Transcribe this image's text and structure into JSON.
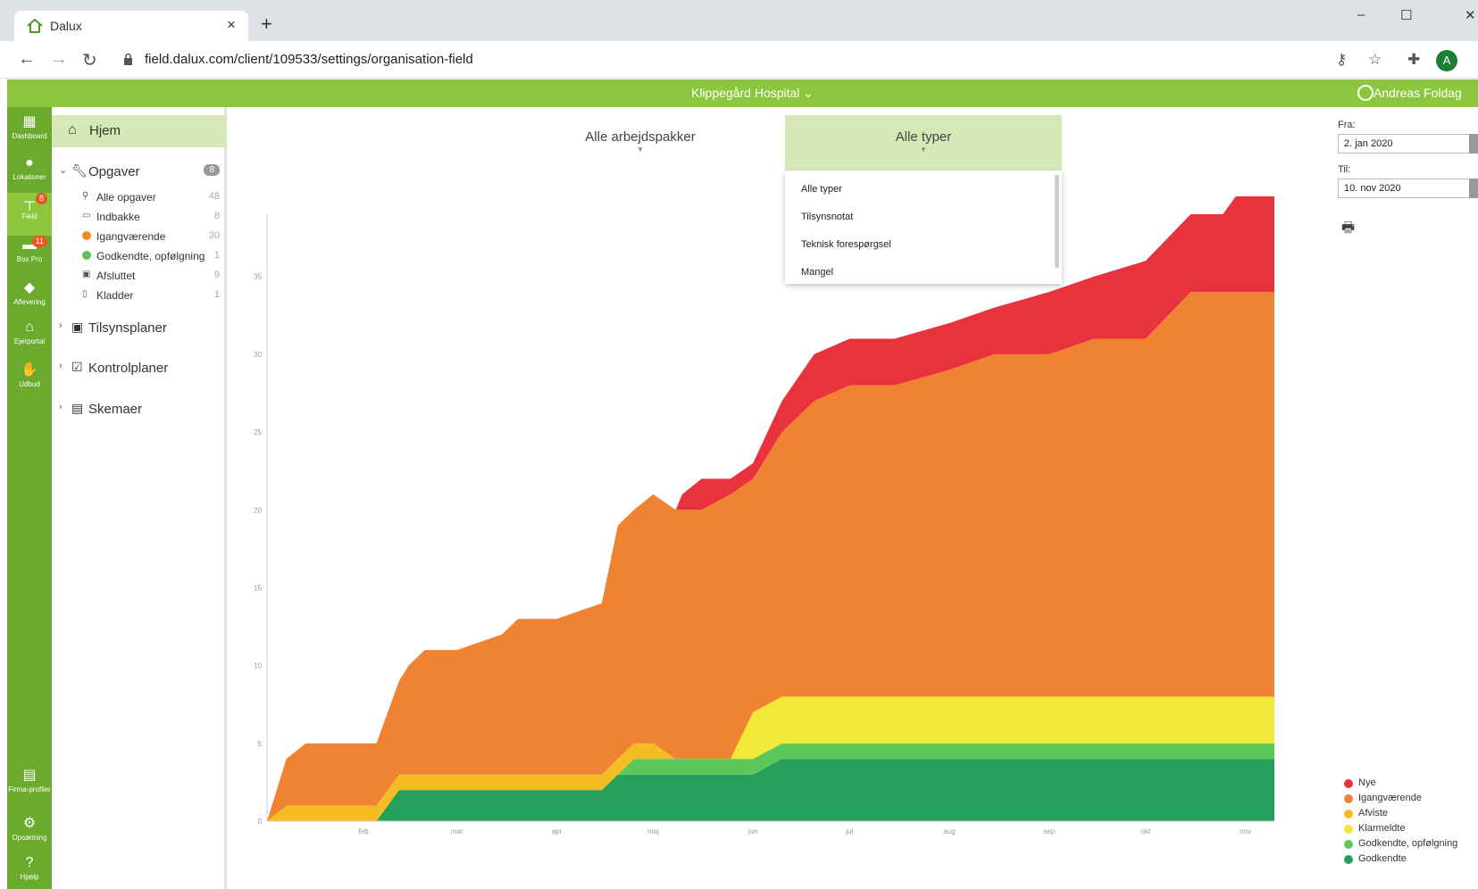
{
  "browser": {
    "tab_title": "Dalux",
    "tab_close": "×",
    "new_tab": "+",
    "url": "field.dalux.com/client/109533/settings/organisation-field",
    "profile_initial": "A",
    "window_controls": [
      "–",
      "☐",
      "✕"
    ]
  },
  "header": {
    "project": "Klippegård Hospital ⌄",
    "user": "Andreas Foldag"
  },
  "rail": [
    {
      "label": "Dashboard",
      "icon": "dashboard-icon",
      "glyph": "▦"
    },
    {
      "label": "Lokationer",
      "icon": "location-pin-icon",
      "glyph": "●"
    },
    {
      "label": "Field",
      "icon": "field-icon",
      "glyph": "┬",
      "badge": "8",
      "active": true
    },
    {
      "label": "Box Pro",
      "icon": "folder-icon",
      "glyph": "▬",
      "badge": "11"
    },
    {
      "label": "Aflevering",
      "icon": "box-icon",
      "glyph": "◆"
    },
    {
      "label": "Ejerportal",
      "icon": "house-icon",
      "glyph": "⌂"
    },
    {
      "label": "Udbud",
      "icon": "handshake-icon",
      "glyph": "✋"
    },
    {
      "label": "Firma-profiler",
      "icon": "building-icon",
      "glyph": "▤"
    },
    {
      "label": "Opsætning",
      "icon": "gear-icon",
      "glyph": "⚙"
    },
    {
      "label": "Hjælp",
      "icon": "help-icon",
      "glyph": "?"
    }
  ],
  "sidebar": {
    "home": "Hjem",
    "opgaver": {
      "label": "Opgaver",
      "count": "8"
    },
    "items": [
      {
        "label": "Alle opgaver",
        "count": "48",
        "icon": "search-icon",
        "glyph": "⚲"
      },
      {
        "label": "Indbakke",
        "count": "8",
        "icon": "inbox-icon",
        "glyph": "▭"
      },
      {
        "label": "Igangværende",
        "count": "30",
        "icon": "status-dot-orange",
        "color": "#f08a24"
      },
      {
        "label": "Godkendte, opfølgning",
        "count": "1",
        "icon": "status-dot-green",
        "color": "#5cc25c"
      },
      {
        "label": "Afsluttet",
        "count": "9",
        "icon": "archive-icon",
        "glyph": "▣"
      },
      {
        "label": "Kladder",
        "count": "1",
        "icon": "draft-icon",
        "glyph": "▯"
      }
    ],
    "sections": [
      {
        "label": "Tilsynsplaner",
        "icon": "clipboard-search-icon"
      },
      {
        "label": "Kontrolplaner",
        "icon": "checkbox-icon"
      },
      {
        "label": "Skemaer",
        "icon": "form-icon"
      }
    ]
  },
  "filters": {
    "packages": "Alle arbejdspakker",
    "types": "Alle typer",
    "type_options": [
      "Alle typer",
      "Tilsynsnotat",
      "Teknisk forespørgsel",
      "Mangel"
    ]
  },
  "dates": {
    "from_label": "Fra:",
    "from_value": "2. jan 2020",
    "to_label": "Til:",
    "to_value": "10. nov 2020"
  },
  "chart_data": {
    "type": "area",
    "stacked": true,
    "x_tick_labels": [
      "feb",
      "mar",
      "apr",
      "maj",
      "jun",
      "jul",
      "aug",
      "sep",
      "okt",
      "nov"
    ],
    "y_tick_labels": [
      "0",
      "5",
      "10",
      "15",
      "20",
      "25",
      "30",
      "35"
    ],
    "ylim": [
      0,
      39
    ],
    "x": [
      "2020-01-02",
      "2020-01-08",
      "2020-01-14",
      "2020-01-25",
      "2020-02-05",
      "2020-02-12",
      "2020-02-15",
      "2020-02-20",
      "2020-02-25",
      "2020-03-01",
      "2020-03-15",
      "2020-03-20",
      "2020-04-01",
      "2020-04-15",
      "2020-04-20",
      "2020-04-25",
      "2020-05-01",
      "2020-05-08",
      "2020-05-10",
      "2020-05-16",
      "2020-05-25",
      "2020-06-01",
      "2020-06-10",
      "2020-06-20",
      "2020-07-01",
      "2020-07-15",
      "2020-08-01",
      "2020-08-15",
      "2020-09-01",
      "2020-09-15",
      "2020-10-01",
      "2020-10-15",
      "2020-10-25",
      "2020-11-01",
      "2020-11-10"
    ],
    "series": [
      {
        "name": "Godkendte",
        "color": "#25a05a",
        "values": [
          0,
          0,
          0,
          0,
          0,
          2,
          2,
          2,
          2,
          2,
          2,
          2,
          2,
          2,
          3,
          3,
          3,
          3,
          3,
          3,
          3,
          3,
          4,
          4,
          4,
          4,
          4,
          4,
          4,
          4,
          4,
          4,
          4,
          4,
          4
        ]
      },
      {
        "name": "Godkendte, opfølgning",
        "color": "#5cc85c",
        "values": [
          0,
          0,
          0,
          0,
          0,
          0,
          0,
          0,
          0,
          0,
          0,
          0,
          0,
          0,
          0,
          1,
          1,
          1,
          1,
          1,
          1,
          1,
          1,
          1,
          1,
          1,
          1,
          1,
          1,
          1,
          1,
          1,
          1,
          1,
          1
        ]
      },
      {
        "name": "Klarmeldte",
        "color": "#f2e838",
        "values": [
          0,
          0,
          0,
          0,
          0,
          0,
          0,
          0,
          0,
          0,
          0,
          0,
          0,
          0,
          0,
          0,
          0,
          0,
          0,
          0,
          0,
          3,
          3,
          3,
          3,
          3,
          3,
          3,
          3,
          3,
          3,
          3,
          3,
          3,
          3
        ]
      },
      {
        "name": "Afviste",
        "color": "#f5bc24",
        "values": [
          0,
          1,
          1,
          1,
          1,
          1,
          1,
          1,
          1,
          1,
          1,
          1,
          1,
          1,
          1,
          1,
          1,
          0,
          0,
          0,
          0,
          0,
          0,
          0,
          0,
          0,
          0,
          0,
          0,
          0,
          0,
          0,
          0,
          0,
          0
        ]
      },
      {
        "name": "Igangværende",
        "color": "#ef8332",
        "values": [
          0,
          3,
          4,
          4,
          4,
          6,
          7,
          8,
          8,
          8,
          9,
          10,
          10,
          11,
          15,
          15,
          16,
          16,
          16,
          16,
          17,
          15,
          17,
          19,
          20,
          20,
          21,
          22,
          22,
          23,
          23,
          26,
          26,
          26,
          26
        ]
      },
      {
        "name": "Nye",
        "color": "#e8323c",
        "values": [
          0,
          0,
          0,
          0,
          0,
          0,
          0,
          0,
          0,
          0,
          0,
          0,
          0,
          0,
          0,
          0,
          0,
          0,
          1,
          2,
          1,
          1,
          2,
          3,
          3,
          3,
          3,
          3,
          4,
          4,
          5,
          5,
          5,
          7,
          8
        ]
      }
    ],
    "legend": [
      "Nye",
      "Igangværende",
      "Afviste",
      "Klarmeldte",
      "Godkendte, opfølgning",
      "Godkendte"
    ]
  }
}
